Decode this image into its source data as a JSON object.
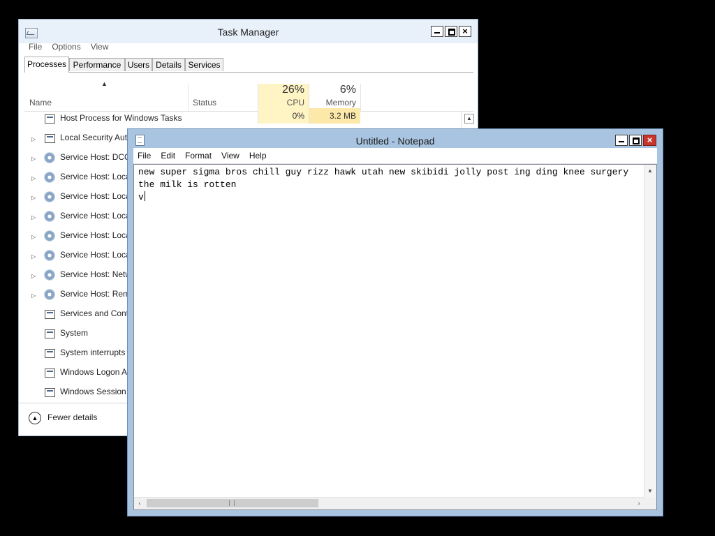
{
  "task_manager": {
    "title": "Task Manager",
    "menu": [
      "File",
      "Options",
      "View"
    ],
    "tabs": [
      "Processes",
      "Performance",
      "Users",
      "Details",
      "Services"
    ],
    "active_tab": "Processes",
    "columns": {
      "name": "Name",
      "status": "Status",
      "cpu_pct": "26%",
      "cpu_label": "CPU",
      "mem_pct": "6%",
      "mem_label": "Memory"
    },
    "processes": [
      {
        "name": "Host Process for Windows Tasks",
        "expandable": false,
        "icon": "process-icon",
        "cpu": "0%",
        "memory": "3.2 MB"
      },
      {
        "name": "Local Security Auth",
        "expandable": true,
        "icon": "process-icon"
      },
      {
        "name": "Service Host: DCO",
        "expandable": true,
        "icon": "gear-icon"
      },
      {
        "name": "Service Host: Loca",
        "expandable": true,
        "icon": "gear-icon"
      },
      {
        "name": "Service Host: Loca",
        "expandable": true,
        "icon": "gear-icon"
      },
      {
        "name": "Service Host: Loca",
        "expandable": true,
        "icon": "gear-icon"
      },
      {
        "name": "Service Host: Loca",
        "expandable": true,
        "icon": "gear-icon"
      },
      {
        "name": "Service Host: Loca",
        "expandable": true,
        "icon": "gear-icon"
      },
      {
        "name": "Service Host: Netw",
        "expandable": true,
        "icon": "gear-icon"
      },
      {
        "name": "Service Host: Rem",
        "expandable": true,
        "icon": "gear-icon"
      },
      {
        "name": "Services and Contr",
        "expandable": false,
        "icon": "process-icon"
      },
      {
        "name": "System",
        "expandable": false,
        "icon": "process-icon"
      },
      {
        "name": "System interrupts",
        "expandable": false,
        "icon": "process-icon"
      },
      {
        "name": "Windows Logon A",
        "expandable": false,
        "icon": "process-icon"
      },
      {
        "name": "Windows Session M",
        "expandable": false,
        "icon": "process-icon"
      }
    ],
    "fewer_details": "Fewer details"
  },
  "notepad": {
    "title": "Untitled - Notepad",
    "menu": [
      "File",
      "Edit",
      "Format",
      "View",
      "Help"
    ],
    "text_lines": [
      "new super sigma bros chill guy rizz hawk utah new skibidi jolly post ing ding knee surgery",
      "the milk is rotten",
      "v"
    ]
  },
  "colors": {
    "desktop": "#000000",
    "notepad_frame": "#a9c4e0",
    "close_button": "#c8372d",
    "cpu_highlight": "#fff4c4"
  }
}
